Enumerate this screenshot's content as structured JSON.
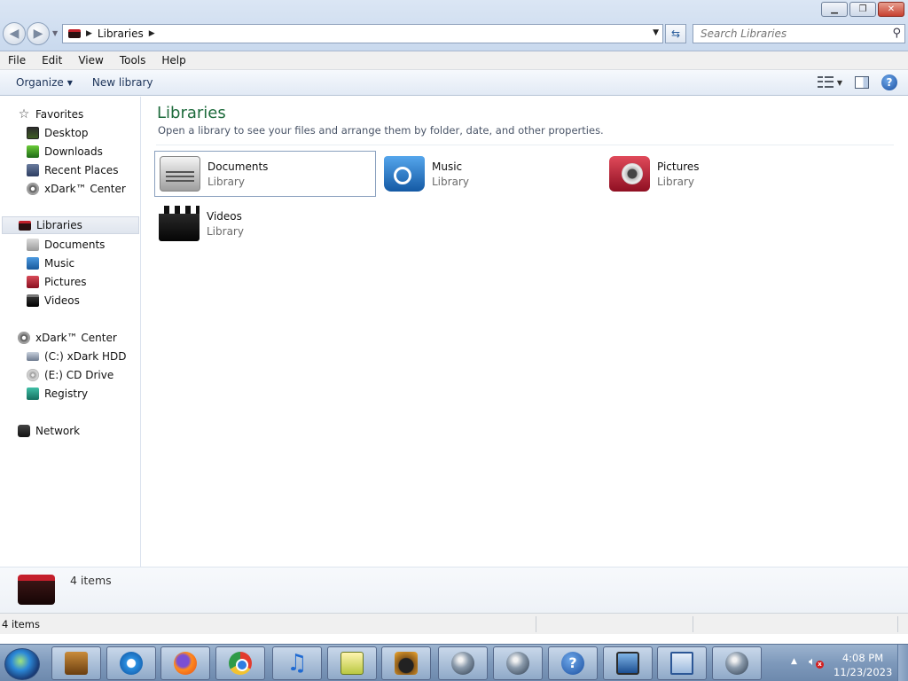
{
  "window": {
    "buttons": {
      "minimize_icon": "minimize-icon",
      "restore_icon": "restore-icon",
      "close_icon": "close-icon"
    }
  },
  "address_bar": {
    "breadcrumb": "Libraries",
    "search_placeholder": "Search Libraries"
  },
  "menu": {
    "items": [
      "File",
      "Edit",
      "View",
      "Tools",
      "Help"
    ]
  },
  "toolbar": {
    "organize_label": "Organize",
    "new_library_label": "New library"
  },
  "navigation": {
    "favorites": {
      "header": "Favorites",
      "items": [
        "Desktop",
        "Downloads",
        "Recent Places",
        "xDark™ Center"
      ]
    },
    "libraries": {
      "header": "Libraries",
      "items": [
        "Documents",
        "Music",
        "Pictures",
        "Videos"
      ]
    },
    "computer": {
      "header": "xDark™ Center",
      "items": [
        "(C:) xDark HDD",
        "(E:) CD Drive",
        "Registry"
      ]
    },
    "network": {
      "header": "Network"
    }
  },
  "content": {
    "title": "Libraries",
    "subtitle": "Open a library to see your files and arrange them by folder, date, and other properties.",
    "libraries": [
      {
        "name": "Documents",
        "type": "Library",
        "icon": "documents-library-icon"
      },
      {
        "name": "Music",
        "type": "Library",
        "icon": "music-library-icon"
      },
      {
        "name": "Pictures",
        "type": "Library",
        "icon": "pictures-library-icon"
      },
      {
        "name": "Videos",
        "type": "Library",
        "icon": "videos-library-icon"
      }
    ]
  },
  "details_pane": {
    "item_count": "4 items"
  },
  "status_bar": {
    "text": "4 items"
  },
  "taskbar": {
    "clock_time": "4:08 PM",
    "clock_date": "11/23/2023",
    "help_glyph": "?"
  },
  "colors": {
    "title_green": "#1e6b3c",
    "taskbar_blue": "#7e99bb",
    "library_red": "#c41f2c"
  }
}
